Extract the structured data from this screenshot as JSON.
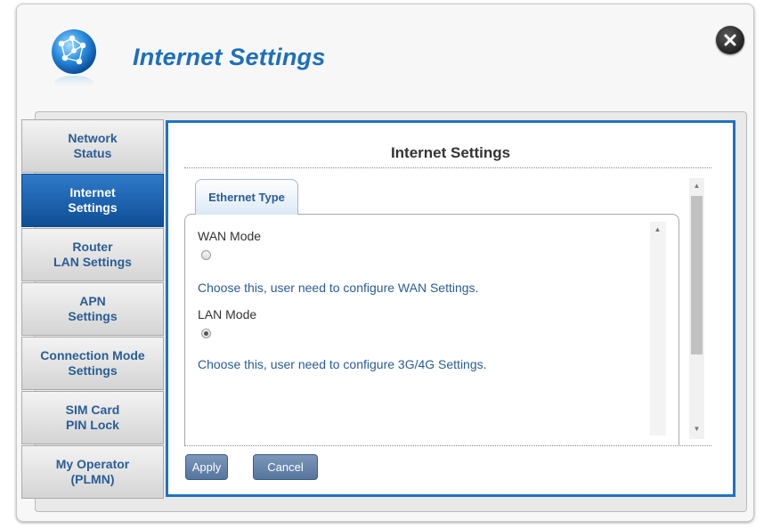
{
  "dialog": {
    "title": "Internet Settings",
    "icon": "globe-icon",
    "close_icon": "close-icon"
  },
  "sidebar": {
    "items": [
      {
        "label": "Network\nStatus",
        "active": false
      },
      {
        "label": "Internet\nSettings",
        "active": true
      },
      {
        "label": "Router\nLAN Settings",
        "active": false
      },
      {
        "label": "APN\nSettings",
        "active": false
      },
      {
        "label": "Connection Mode\nSettings",
        "active": false
      },
      {
        "label": "SIM Card\nPIN Lock",
        "active": false
      },
      {
        "label": "My Operator\n(PLMN)",
        "active": false
      }
    ]
  },
  "content": {
    "title": "Internet Settings",
    "tab_label": "Ethernet Type",
    "wan_mode_label": "WAN Mode",
    "wan_mode_checked": false,
    "wan_hint": "Choose this, user need to configure WAN Settings.",
    "lan_mode_label": "LAN Mode",
    "lan_mode_checked": true,
    "lan_hint": "Choose this, user need to configure 3G/4G Settings.",
    "apply_label": "Apply",
    "cancel_label": "Cancel"
  },
  "colors": {
    "accent": "#1f73c3",
    "active_nav": "#1a5fa8",
    "link_text": "#2a5d94"
  }
}
